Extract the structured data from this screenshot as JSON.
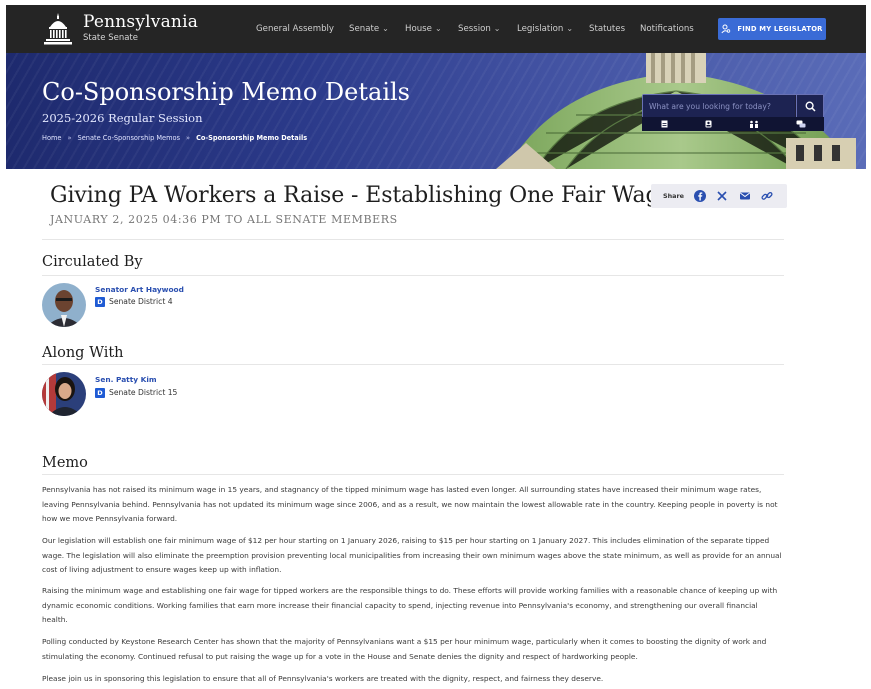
{
  "header": {
    "site_title": "Pennsylvania",
    "site_subtitle": "State Senate",
    "nav": [
      {
        "label": "General Assembly",
        "dropdown": false
      },
      {
        "label": "Senate",
        "dropdown": true
      },
      {
        "label": "House",
        "dropdown": true
      },
      {
        "label": "Session",
        "dropdown": true
      },
      {
        "label": "Legislation",
        "dropdown": true
      },
      {
        "label": "Statutes",
        "dropdown": false
      },
      {
        "label": "Notifications",
        "dropdown": false
      }
    ],
    "find_button": "FIND MY LEGISLATOR"
  },
  "hero": {
    "title": "Co-Sponsorship Memo Details",
    "session": "2025-2026 Regular Session",
    "breadcrumbs": [
      "Home",
      "Senate Co-Sponsorship Memos",
      "Co-Sponsorship Memo Details"
    ],
    "search_placeholder": "What are you looking for today?"
  },
  "memo": {
    "title": "Giving PA Workers a Raise - Establishing One Fair Wage",
    "date_line": "JANUARY 2, 2025 04:36 PM TO ALL SENATE MEMBERS",
    "share_label": "Share"
  },
  "circulated_by": {
    "heading": "Circulated By",
    "name": "Senator Art Haywood",
    "party": "D",
    "district": "Senate District 4"
  },
  "along_with": {
    "heading": "Along With",
    "name": "Sen. Patty Kim",
    "party": "D",
    "district": "Senate District 15"
  },
  "memo_body": {
    "heading": "Memo",
    "paragraphs": [
      "Pennsylvania has not raised its minimum wage in 15 years, and stagnancy of the tipped minimum wage has lasted even longer. All surrounding states have increased their minimum wage rates, leaving Pennsylvania behind. Pennsylvania has not updated its minimum wage since 2006, and as a result, we now maintain the lowest allowable rate in the country. Keeping people in poverty is not how we move Pennsylvania forward.",
      "Our legislation will establish one fair minimum wage of $12 per hour starting on 1 January 2026, raising to $15 per hour starting on 1 January 2027. This includes elimination of the separate tipped wage. The legislation will also eliminate the preemption provision preventing local municipalities from increasing their own minimum wages above the state minimum, as well as provide for an annual cost of living adjustment to ensure wages keep up with inflation.",
      "Raising the minimum wage and establishing one fair wage for tipped workers are the responsible things to do. These efforts will provide working families with a reasonable chance of keeping up with dynamic economic conditions. Working families that earn more increase their financial capacity to spend, injecting revenue into Pennsylvania's economy, and strengthening our overall financial health.",
      "Polling conducted by Keystone Research Center has shown that the majority of Pennsylvanians want a $15 per hour minimum wage, particularly when it comes to boosting the dignity of work and stimulating the economy. Continued refusal to put raising the wage up for a vote in the House and Senate denies the dignity and respect of hardworking people.",
      "Please join us in sponsoring this legislation to ensure that all of Pennsylvania's workers are treated with the dignity, respect, and fairness they deserve."
    ]
  }
}
